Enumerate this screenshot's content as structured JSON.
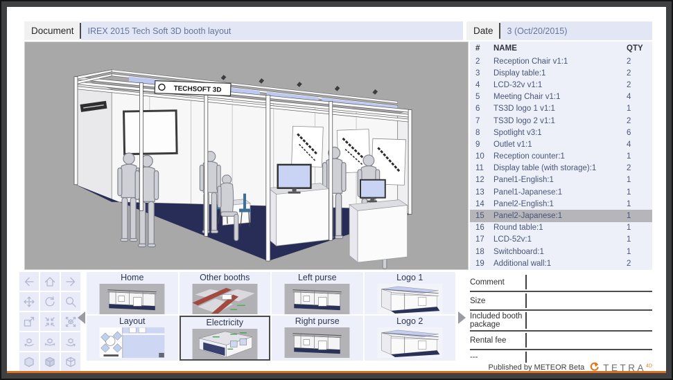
{
  "header": {
    "document_label": "Document",
    "document_title": "IREX 2015 Tech Soft 3D booth layout",
    "date_label": "Date",
    "date_value": "3 (Oct/20/2015)"
  },
  "viewport": {
    "banner_text": "TECHSOFT 3D"
  },
  "parts_table": {
    "columns": [
      "#",
      "NAME",
      "QTY"
    ],
    "selected_row": "15",
    "rows": [
      [
        "2",
        "Reception Chair v1:1",
        "2"
      ],
      [
        "3",
        "Display table:1",
        "2"
      ],
      [
        "4",
        "LCD-32v v1:1",
        "2"
      ],
      [
        "5",
        "Meeting Chair v1:1",
        "4"
      ],
      [
        "6",
        "TS3D logo 1 v1:1",
        "1"
      ],
      [
        "7",
        "TS3D logo 2 v1:1",
        "2"
      ],
      [
        "8",
        "Spotlight v3:1",
        "6"
      ],
      [
        "9",
        "Outlet v1:1",
        "4"
      ],
      [
        "10",
        "Reception counter:1",
        "1"
      ],
      [
        "11",
        "Display table (with storage):1",
        "2"
      ],
      [
        "12",
        "Panel1-English:1",
        "1"
      ],
      [
        "13",
        "Panel1-Japanese:1",
        "1"
      ],
      [
        "14",
        "Panel2-English:1",
        "1"
      ],
      [
        "15",
        "Panel2-Japanese:1",
        "1"
      ],
      [
        "16",
        "Round table:1",
        "1"
      ],
      [
        "17",
        "LCD-52v:1",
        "1"
      ],
      [
        "18",
        "Switchboard:1",
        "1"
      ],
      [
        "19",
        "Additional wall:1",
        "2"
      ]
    ]
  },
  "toolbar": {
    "buttons": [
      {
        "name": "prev-view",
        "icon": "arrow-left-icon"
      },
      {
        "name": "home-view",
        "icon": "home-icon"
      },
      {
        "name": "next-view",
        "icon": "arrow-right-icon"
      },
      {
        "name": "pan",
        "icon": "pan-arrows-icon"
      },
      {
        "name": "orbit",
        "icon": "rotate-icon"
      },
      {
        "name": "zoom",
        "icon": "magnifier-icon"
      },
      {
        "name": "zoom-window",
        "icon": "zoom-window-icon"
      },
      {
        "name": "zoom-fit",
        "icon": "arrows-inward-icon"
      },
      {
        "name": "fit-all",
        "icon": "cube-expand-icon"
      },
      {
        "name": "spin-left",
        "icon": "cube-orbit-left-icon"
      },
      {
        "name": "spin-down",
        "icon": "cube-orbit-down-icon"
      },
      {
        "name": "spin-right",
        "icon": "cube-orbit-right-icon"
      },
      {
        "name": "render-solid",
        "icon": "cube-solid-icon"
      },
      {
        "name": "render-shaded",
        "icon": "cube-shaded-icon"
      },
      {
        "name": "render-wireframe",
        "icon": "cube-wireframe-icon"
      }
    ]
  },
  "carousel": {
    "selected": "Electricity",
    "thumbs": [
      {
        "label": "Home",
        "image": "booth-thumb"
      },
      {
        "label": "Other booths",
        "image": "floorplan-roads-thumb"
      },
      {
        "label": "Left purse",
        "image": "booth-thumb"
      },
      {
        "label": "Logo 1",
        "image": "booth-light-thumb"
      },
      {
        "label": "Layout",
        "image": "layout-2d-thumb"
      },
      {
        "label": "Electricity",
        "image": "electricity-thumb"
      },
      {
        "label": "Right purse",
        "image": "booth-thumb"
      },
      {
        "label": "Logo 2",
        "image": "booth-light-thumb"
      }
    ]
  },
  "form": {
    "fields": [
      {
        "label": "Comment",
        "value": ""
      },
      {
        "label": "Size",
        "value": ""
      },
      {
        "label": "Included booth package",
        "value": ""
      },
      {
        "label": "Rental fee",
        "value": ""
      },
      {
        "label": "---",
        "value": ""
      }
    ]
  },
  "footer": {
    "published": "Published by METEOR Beta",
    "brand": "TETRA",
    "brand_sup": "4D"
  },
  "colors": {
    "accent_orange": "#D96F1E",
    "field_lavender": "#E3E7F5",
    "table_background": "#EDF0F9",
    "selected_row_gray": "#B5B5BA",
    "viewport_gray": "#A8A8A8",
    "booth_floor_navy": "#272D56",
    "chair_teal": "#2F7386"
  }
}
